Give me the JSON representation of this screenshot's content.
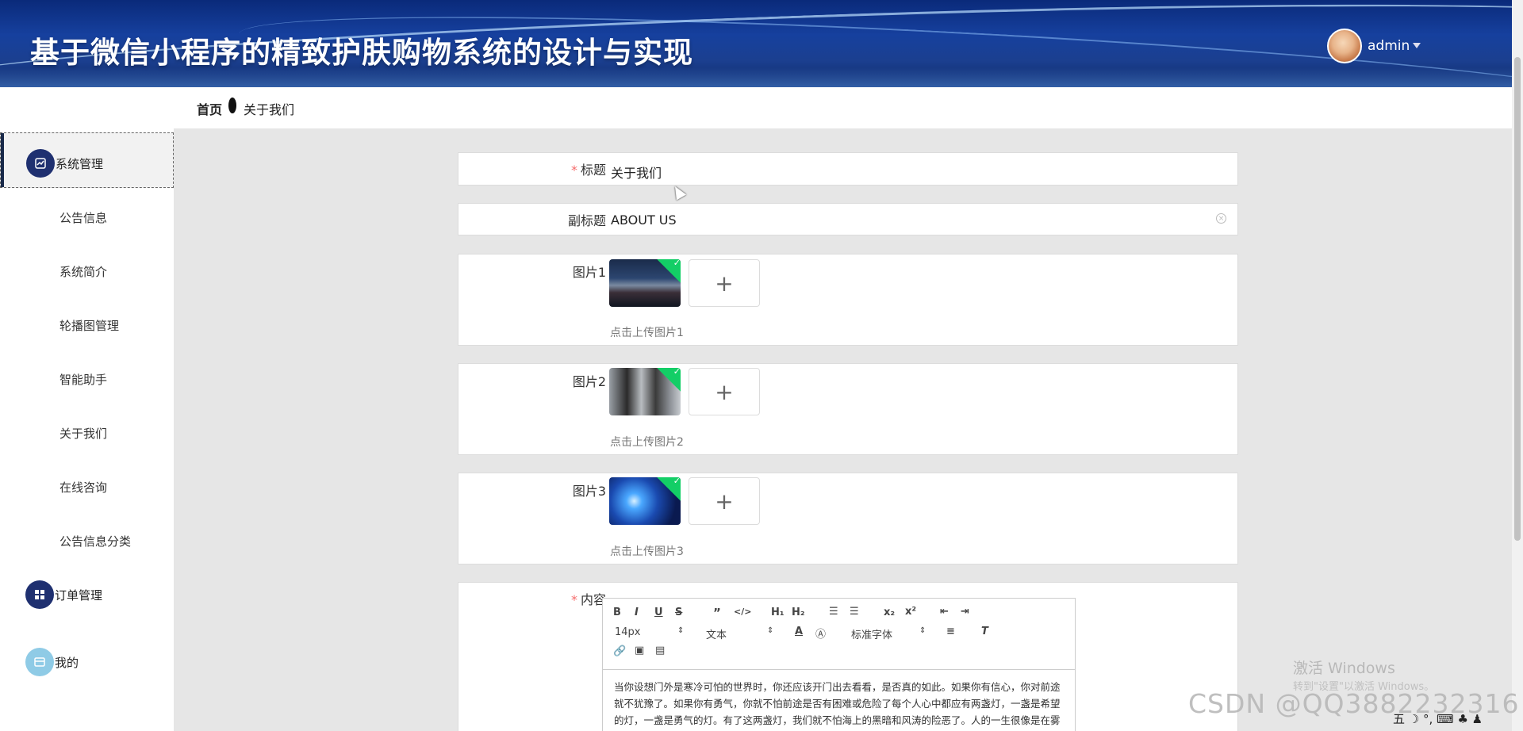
{
  "header": {
    "title": "基于微信小程序的精致护肤购物系统的设计与实现",
    "user": "admin"
  },
  "breadcrumb": {
    "home": "首页",
    "current": "关于我们"
  },
  "sidebar": {
    "groups": [
      {
        "label": "系统管理",
        "icon": "chart-icon"
      },
      {
        "label": "订单管理",
        "icon": "grid-icon"
      },
      {
        "label": "我的",
        "icon": "card-icon"
      }
    ],
    "subitems": [
      "公告信息",
      "系统简介",
      "轮播图管理",
      "智能助手",
      "关于我们",
      "在线咨询",
      "公告信息分类"
    ]
  },
  "form": {
    "title_label": "标题",
    "title_value": "关于我们",
    "subtitle_label": "副标题",
    "subtitle_value": "ABOUT US",
    "pic1_label": "图片1",
    "pic1_tip": "点击上传图片1",
    "pic2_label": "图片2",
    "pic2_tip": "点击上传图片2",
    "pic3_label": "图片3",
    "pic3_tip": "点击上传图片3",
    "content_label": "内容",
    "upload_plus": "+"
  },
  "editor": {
    "font_size": "14px",
    "block_type": "文本",
    "font_family": "标准字体",
    "text": "当你设想门外是寒冷可怕的世界时，你还应该开门出去看看，是否真的如此。如果你有信心，你对前途就不犹豫了。如果你有勇气，你就不怕前途是否有困难或危险了每个人心中都应有两盏灯，一盏是希望的灯，一盏是勇气的灯。有了这两盏灯，我们就不怕海上的黑暗和风涛的险恶了。人的一生很像是在雾中行走。远远望去，只是迷蒙一片，辨不出方向和吉凶。可是，当你鼓起勇气，放下"
  },
  "overlay": {
    "activate_title": "激活 Windows",
    "activate_sub": "转到\"设置\"以激活 Windows。",
    "csdn": "CSDN @QQ3882232316",
    "tray": "五 ☽ °, ⌨ ♣ ♟"
  }
}
